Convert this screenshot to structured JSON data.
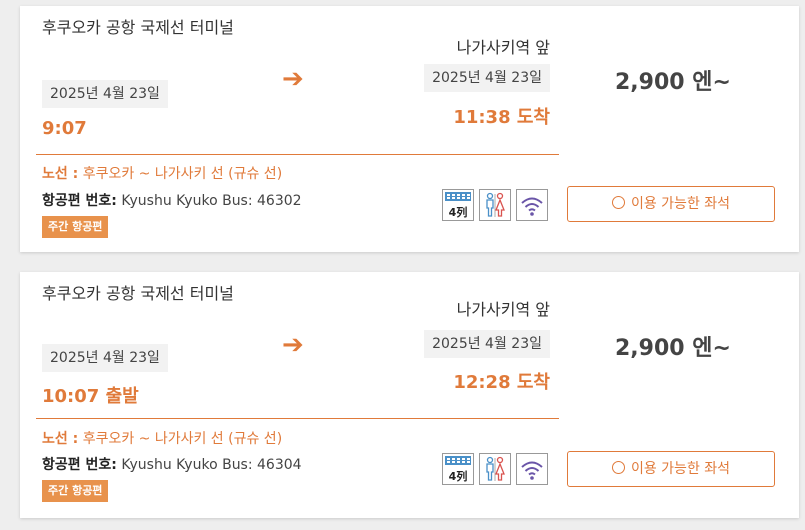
{
  "results": [
    {
      "origin": "후쿠오카 공항 국제선 터미널",
      "origin_date": "2025년 4월 23일",
      "departure_time": "9:07",
      "destination": "나가사키역 앞",
      "destination_date": "2025년 4월 23일",
      "arrival_time": "11:38 도착",
      "price": "2,900 엔~",
      "route_label": "노선 :",
      "route_value": "후쿠오카 ~ 나가사키 선 (규슈 선)",
      "flight_label": "항공편 번호:",
      "flight_value": "Kyushu Kyuko Bus: 46302",
      "badge": "주간 항공편",
      "amenity_seats_label": "4列",
      "seats_button": "이용 가능한 좌석"
    },
    {
      "origin": "후쿠오카 공항 국제선 터미널",
      "origin_date": "2025년 4월 23일",
      "departure_time": "10:07 출발",
      "destination": "나가사키역 앞",
      "destination_date": "2025년 4월 23일",
      "arrival_time": "12:28 도착",
      "price": "2,900 엔~",
      "route_label": "노선 :",
      "route_value": "후쿠오카 ~ 나가사키 선 (규슈 선)",
      "flight_label": "항공편 번호:",
      "flight_value": "Kyushu Kyuko Bus: 46304",
      "badge": "주간 항공편",
      "amenity_seats_label": "4列",
      "seats_button": "이용 가능한 좌석"
    }
  ],
  "colors": {
    "accent": "#e07a3a",
    "badge": "#e8924c",
    "chip": "#f2f2f2"
  },
  "icons": [
    "arrow-right-icon",
    "seat-layout-icon",
    "restroom-icon",
    "wifi-icon",
    "circle-icon"
  ]
}
